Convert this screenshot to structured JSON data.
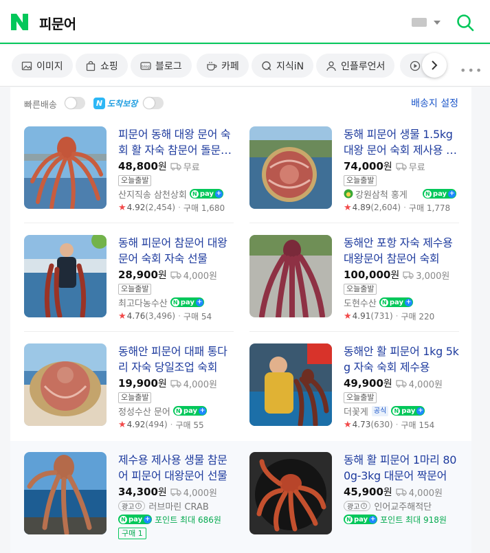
{
  "header": {
    "query": "피문어"
  },
  "tabs": [
    {
      "label": "이미지",
      "icon": "image-icon"
    },
    {
      "label": "쇼핑",
      "icon": "shopping-bag-icon"
    },
    {
      "label": "블로그",
      "icon": "blog-icon"
    },
    {
      "label": "카페",
      "icon": "cafe-cup-icon"
    },
    {
      "label": "지식iN",
      "icon": "kin-q-icon"
    },
    {
      "label": "인플루언서",
      "icon": "person-icon"
    },
    {
      "label": "",
      "icon": "play-icon"
    }
  ],
  "filters": {
    "fast_delivery": "빠른배송",
    "arrival_guarantee": "도착보장",
    "arrival_n": "N",
    "ship_setting": "배송지 설정"
  },
  "products": [
    {
      "title": "피문어 동해 대왕 문어 숙회 활 자숙 참문어 돌문어 자연산 통발 수산물 선물세트",
      "price": "48,800",
      "won": "원",
      "ship": "무료",
      "badge": "오늘출발",
      "seller": "산지직송 삼천상회",
      "rating": "4.92",
      "reviews": "(2,454)",
      "purchase": "구매 1,680"
    },
    {
      "title": "동해 피문어 생물 1.5kg 대왕 문어 숙회 제사용 선물세트",
      "price": "74,000",
      "won": "원",
      "ship": "무료",
      "badge": "오늘출발",
      "seller": "강원삼척 홍게",
      "rating": "4.89",
      "reviews": "(2,604)",
      "purchase": "구매 1,778"
    },
    {
      "title": "동해 피문어 참문어 대왕 문어 숙회 자숙 선물",
      "price": "28,900",
      "won": "원",
      "ship": "4,000원",
      "badge": "오늘출발",
      "seller": "최고다농수산",
      "rating": "4.76",
      "reviews": "(3,496)",
      "purchase": "구매 54"
    },
    {
      "title": "동해안 포항 자숙 제수용 대왕문어 참문어 숙회",
      "price": "100,000",
      "won": "원",
      "ship": "3,000원",
      "badge": "오늘출발",
      "seller": "도현수산",
      "rating": "4.91",
      "reviews": "(731)",
      "purchase": "구매 220"
    },
    {
      "title": "동해안 피문어 대패 통다리 자숙 당일조업 숙회",
      "price": "19,900",
      "won": "원",
      "ship": "4,000원",
      "badge": "오늘출발",
      "seller": "정성수산 문어",
      "rating": "4.92",
      "reviews": "(494)",
      "purchase": "구매 55"
    },
    {
      "title": "동해안 활 피문어 1kg 5kg 자숙 숙회 제수용",
      "price": "49,900",
      "won": "원",
      "ship": "4,000원",
      "badge": "오늘출발",
      "seller": "더꽃게",
      "official": "공식",
      "rating": "4.73",
      "reviews": "(630)",
      "purchase": "구매 154"
    },
    {
      "title": "제수용 제사용 생물 참문어 피문어 대왕문어 선물",
      "price": "34,300",
      "won": "원",
      "ship": "4,000원",
      "ad": "광고",
      "seller": "러브마린 CRAB",
      "point": "포인트 최대 686원",
      "buy": "구매 1"
    },
    {
      "title": "동해 활 피문어 1마리 800g-3kg 대문어 짝문어",
      "price": "45,900",
      "won": "원",
      "ship": "4,000원",
      "ad": "광고",
      "seller": "인어교주해적단",
      "point": "포인트 최대 918원"
    }
  ],
  "npay": {
    "n": "N",
    "label": "pay",
    "plus": "+"
  },
  "colors": {
    "brand": "#03c75a",
    "link": "#1a55c9",
    "title": "#1e3b9e",
    "star": "#f24a4a"
  }
}
